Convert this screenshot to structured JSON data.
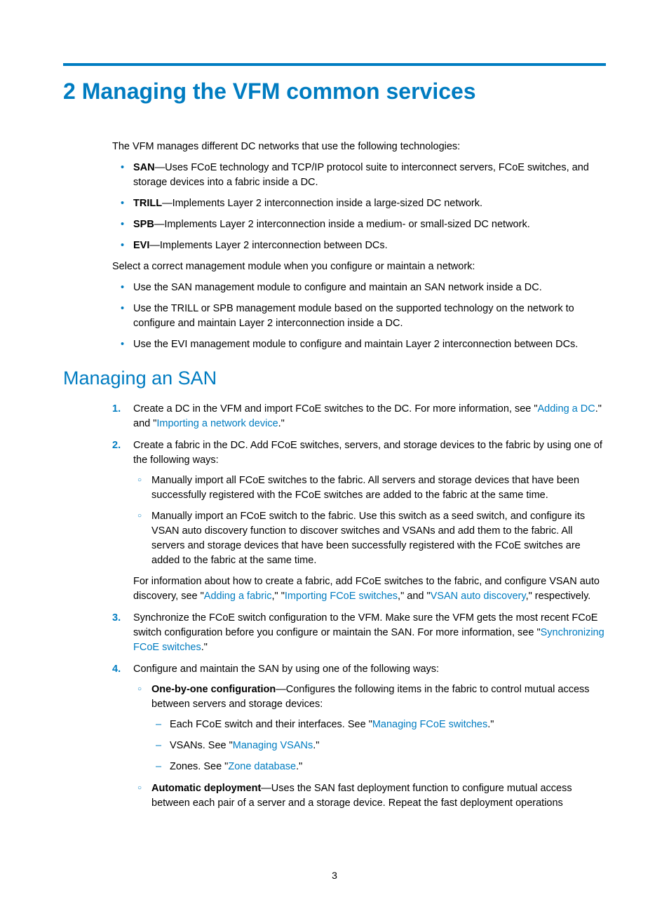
{
  "h1": "2 Managing the VFM common services",
  "intro": "The VFM manages different DC networks that use the following technologies:",
  "tech": {
    "san_b": "SAN",
    "san_t": "—Uses FCoE technology and TCP/IP protocol suite to interconnect servers, FCoE switches, and storage devices into a fabric inside a DC.",
    "trill_b": "TRILL",
    "trill_t": "—Implements Layer 2 interconnection inside a large-sized DC network.",
    "spb_b": "SPB",
    "spb_t": "—Implements Layer 2 interconnection inside a medium- or small-sized DC network.",
    "evi_b": "EVI",
    "evi_t": "—Implements Layer 2 interconnection between DCs."
  },
  "select_p": "Select a correct management module when you configure or maintain a network:",
  "select_items": {
    "a": "Use the SAN management module to configure and maintain an SAN network inside a DC.",
    "b": "Use the TRILL or SPB management module based on the supported technology on the network to configure and maintain Layer 2 interconnection inside a DC.",
    "c": "Use the EVI management module to configure and maintain Layer 2 interconnection between DCs."
  },
  "h2": "Managing an SAN",
  "steps": {
    "s1": {
      "pre": "Create a DC in the VFM and import FCoE switches to the DC. For more information, see \"",
      "link1": "Adding a DC",
      "mid": ".\" and \"",
      "link2": "Importing a network device",
      "post": ".\""
    },
    "s2": {
      "txt": "Create a fabric in the DC. Add FCoE switches, servers, and storage devices to the fabric by using one of the following ways:",
      "sub": {
        "a": "Manually import all FCoE switches to the fabric. All servers and storage devices that have been successfully registered with the FCoE switches are added to the fabric at the same time.",
        "b": "Manually import an FCoE switch to the fabric. Use this switch as a seed switch, and configure its VSAN auto discovery function to discover switches and VSANs and add them to the fabric. All servers and storage devices that have been successfully registered with the FCoE switches are added to the fabric at the same time."
      },
      "info_pre": "For information about how to create a fabric, add FCoE switches to the fabric, and configure VSAN auto discovery, see \"",
      "info_l1": "Adding a fabric",
      "info_m1": ",\" \"",
      "info_l2": "Importing FCoE switches",
      "info_m2": ",\" and \"",
      "info_l3": "VSAN auto discovery",
      "info_post": ",\" respectively."
    },
    "s3": {
      "pre": "Synchronize the FCoE switch configuration to the VFM. Make sure the VFM gets the most recent FCoE switch configuration before you configure or maintain the SAN. For more information, see \"",
      "link": "Synchronizing FCoE switches",
      "post": ".\""
    },
    "s4": {
      "txt": "Configure and maintain the SAN by using one of the following ways:",
      "obo_b": "One-by-one configuration",
      "obo_t": "—Configures the following items in the fabric to control mutual access between servers and storage devices:",
      "d1_pre": "Each FCoE switch and their interfaces. See \"",
      "d1_link": "Managing FCoE switches",
      "d1_post": ".\"",
      "d2_pre": "VSANs. See \"",
      "d2_link": "Managing VSANs",
      "d2_post": ".\"",
      "d3_pre": "Zones. See \"",
      "d3_link": "Zone database",
      "d3_post": ".\"",
      "auto_b": "Automatic deployment",
      "auto_t": "—Uses the SAN fast deployment function to configure mutual access between each pair of a server and a storage device. Repeat the fast deployment operations"
    }
  },
  "page_no": "3"
}
